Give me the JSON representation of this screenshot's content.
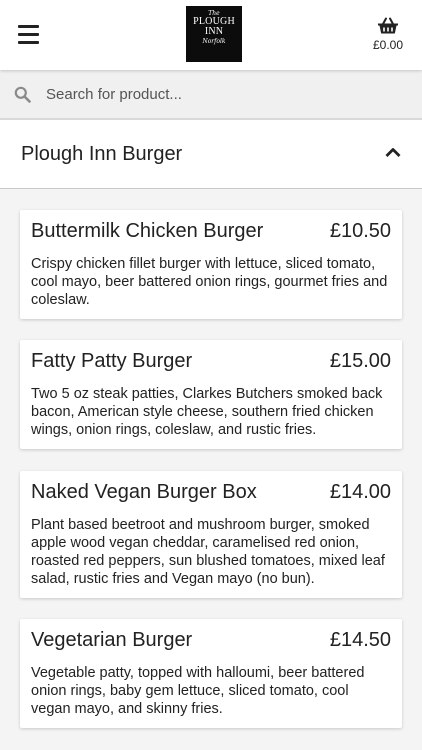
{
  "header": {
    "logo": {
      "the": "The",
      "name_line1": "PLOUGH",
      "name_line2": "INN",
      "place": "Norfolk"
    },
    "cart": {
      "total": "£0.00"
    }
  },
  "search": {
    "placeholder": "Search for product..."
  },
  "category": {
    "title": "Plough Inn Burger"
  },
  "products": [
    {
      "name": "Buttermilk Chicken Burger",
      "price": "£10.50",
      "description": "Crispy chicken fillet burger with lettuce, sliced tomato, cool mayo, beer battered onion rings, gourmet fries and coleslaw."
    },
    {
      "name": "Fatty Patty Burger",
      "price": "£15.00",
      "description": "Two 5 oz steak patties, Clarkes Butchers smoked back bacon, American style cheese, southern fried chicken wings, onion rings, coleslaw, and rustic fries."
    },
    {
      "name": "Naked Vegan Burger Box",
      "price": "£14.00",
      "description": "Plant based beetroot and mushroom burger, smoked apple wood vegan cheddar, caramelised red onion, roasted red peppers, sun blushed tomatoes, mixed leaf salad, rustic fries and Vegan mayo (no bun)."
    },
    {
      "name": "Vegetarian Burger",
      "price": "£14.50",
      "description": "Vegetable patty, topped with halloumi, beer battered onion rings, baby gem lettuce, sliced tomato, cool vegan mayo, and skinny fries."
    }
  ]
}
